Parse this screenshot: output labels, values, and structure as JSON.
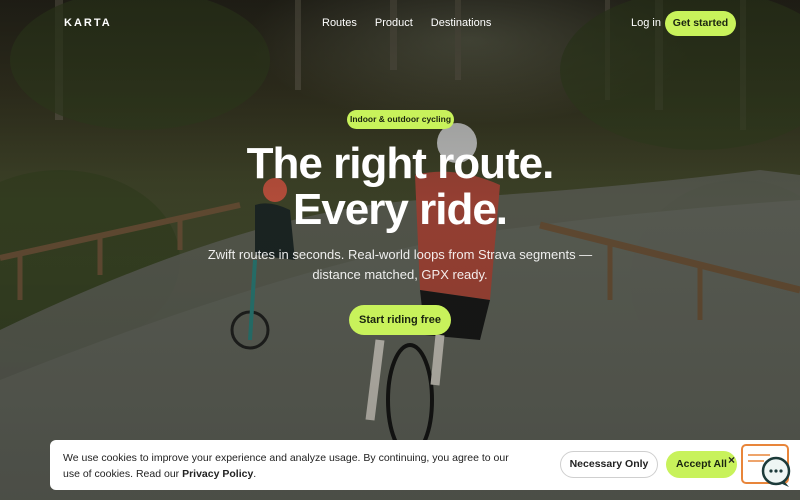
{
  "nav": {
    "logo": "KARTA",
    "links": [
      "Routes",
      "Product",
      "Destinations"
    ],
    "login": "Log in",
    "cta": "Get started"
  },
  "hero": {
    "badge": "Indoor & outdoor cycling",
    "headline_line1": "The right route.",
    "headline_line2": "Every ride.",
    "sub_line1": "Zwift routes in seconds. Real-world loops from Strava segments —",
    "sub_line2": "distance matched, GPX ready.",
    "cta": "Start riding free"
  },
  "cookie": {
    "text": "We use cookies to improve your experience and analyze usage. By continuing, you agree to our use of cookies. Read our",
    "policy_link": "Privacy Policy",
    "necessary_label": "Necessary Only",
    "accept_label": "Accept All",
    "close_glyph": "×"
  },
  "colors": {
    "accent": "#c8f25b",
    "chat_widget": "#e8853a"
  },
  "icons": [
    "close-icon",
    "chat-icon"
  ]
}
